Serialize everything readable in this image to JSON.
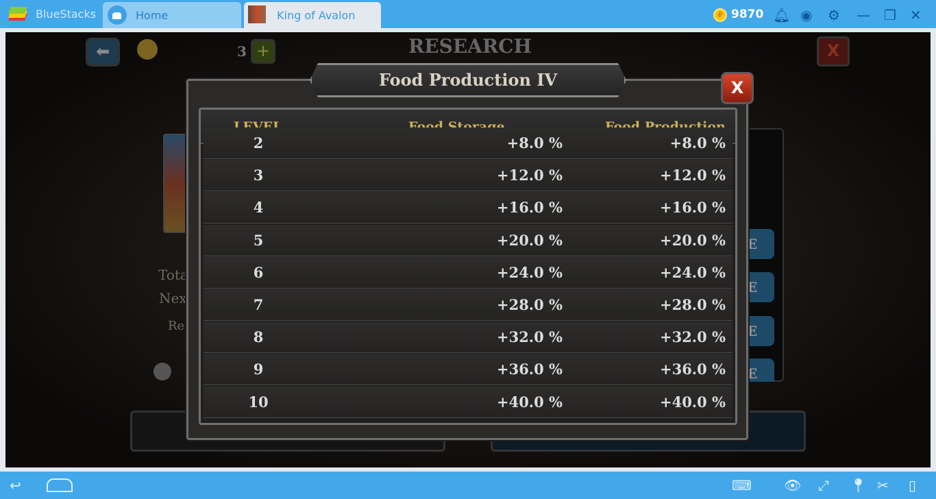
{
  "app": {
    "brand": "BlueStacks",
    "tabs": [
      {
        "label": "Home",
        "icon": "home-icon"
      },
      {
        "label": "King of Avalon",
        "icon": "game-icon"
      }
    ],
    "coins": "9870",
    "coin_symbol": "₽"
  },
  "game": {
    "header_title": "RESEARCH",
    "gold_count": "3",
    "left_labels": [
      "Tota",
      "Nex",
      "Re"
    ],
    "side_button_letter": "E"
  },
  "modal": {
    "title": "Food Production IV",
    "close_label": "X",
    "columns": [
      "LEVEL",
      "Food Storage",
      "Food Production"
    ],
    "rows": [
      {
        "level": "2",
        "storage": "+8.0 %",
        "production": "+8.0 %"
      },
      {
        "level": "3",
        "storage": "+12.0 %",
        "production": "+12.0 %"
      },
      {
        "level": "4",
        "storage": "+16.0 %",
        "production": "+16.0 %"
      },
      {
        "level": "5",
        "storage": "+20.0 %",
        "production": "+20.0 %"
      },
      {
        "level": "6",
        "storage": "+24.0 %",
        "production": "+24.0 %"
      },
      {
        "level": "7",
        "storage": "+28.0 %",
        "production": "+28.0 %"
      },
      {
        "level": "8",
        "storage": "+32.0 %",
        "production": "+32.0 %"
      },
      {
        "level": "9",
        "storage": "+36.0 %",
        "production": "+36.0 %"
      },
      {
        "level": "10",
        "storage": "+40.0 %",
        "production": "+40.0 %"
      }
    ]
  },
  "colors": {
    "chrome": "#42a8ea",
    "header_gold": "#cdb05a",
    "close_red": "#c0381f"
  }
}
